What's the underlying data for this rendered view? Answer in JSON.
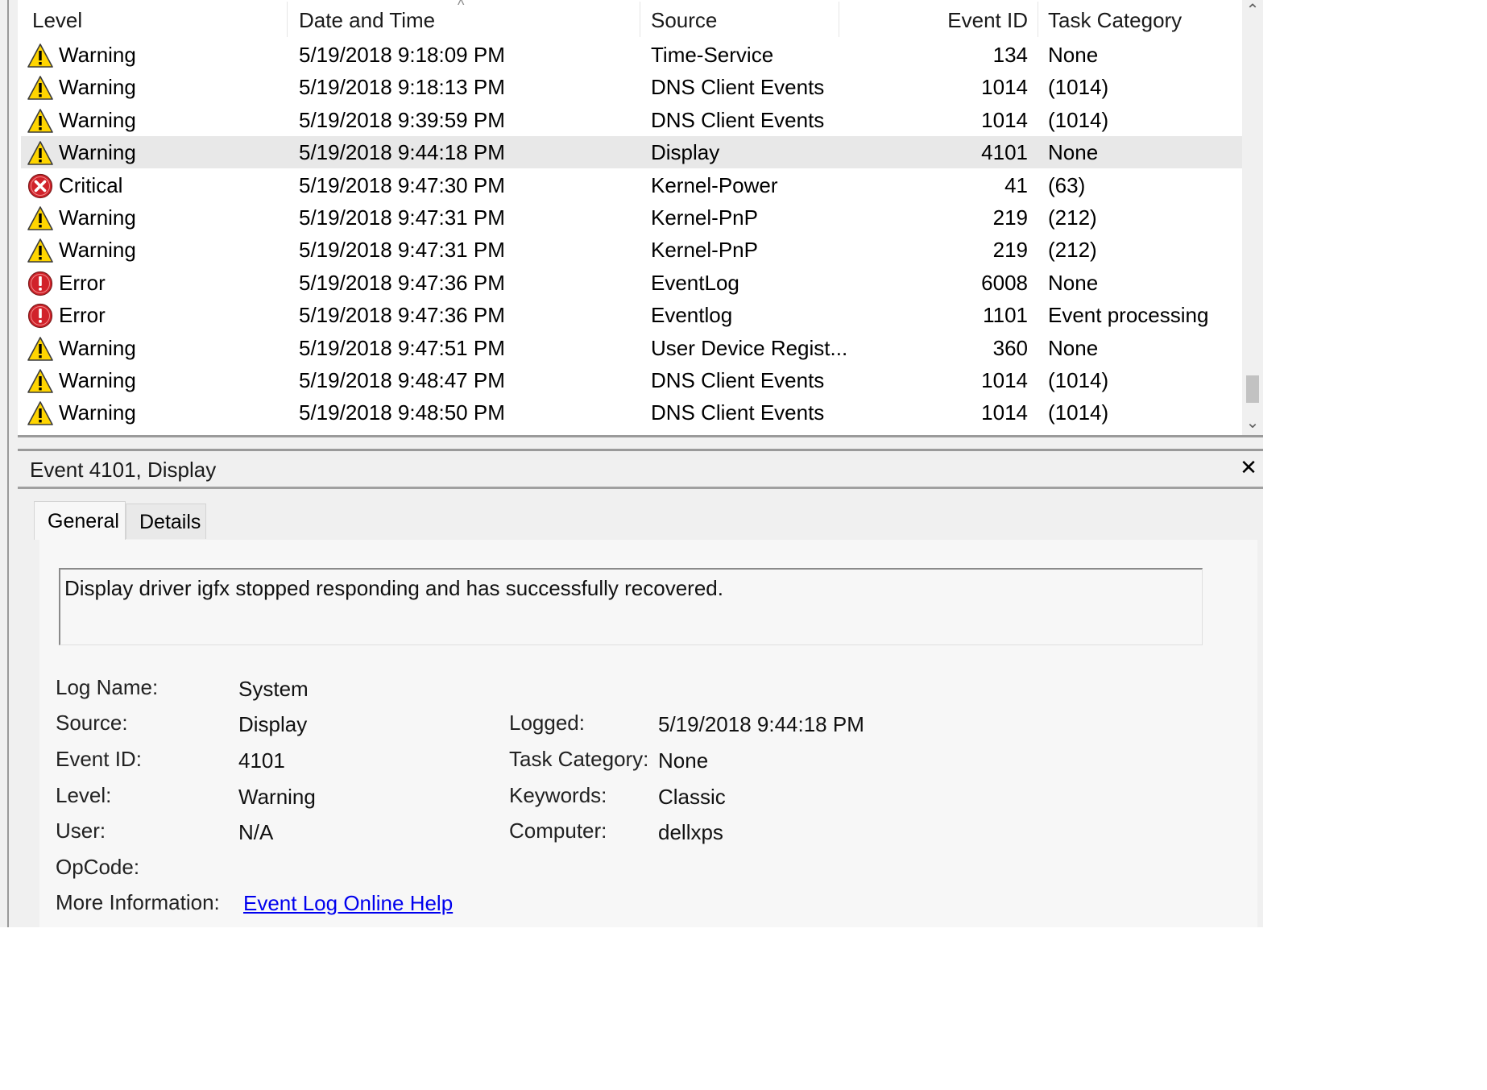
{
  "columns": {
    "level": "Level",
    "date": "Date and Time",
    "source": "Source",
    "event_id": "Event ID",
    "task": "Task Category"
  },
  "rows": [
    {
      "level": "Warning",
      "icon": "warning-icon",
      "date": "5/19/2018 9:18:09 PM",
      "source": "Time-Service",
      "event_id": "134",
      "task": "None"
    },
    {
      "level": "Warning",
      "icon": "warning-icon",
      "date": "5/19/2018 9:18:13 PM",
      "source": "DNS Client Events",
      "event_id": "1014",
      "task": "(1014)"
    },
    {
      "level": "Warning",
      "icon": "warning-icon",
      "date": "5/19/2018 9:39:59 PM",
      "source": "DNS Client Events",
      "event_id": "1014",
      "task": "(1014)"
    },
    {
      "level": "Warning",
      "icon": "warning-icon",
      "date": "5/19/2018 9:44:18 PM",
      "source": "Display",
      "event_id": "4101",
      "task": "None",
      "selected": true
    },
    {
      "level": "Critical",
      "icon": "critical-icon",
      "date": "5/19/2018 9:47:30 PM",
      "source": "Kernel-Power",
      "event_id": "41",
      "task": "(63)"
    },
    {
      "level": "Warning",
      "icon": "warning-icon",
      "date": "5/19/2018 9:47:31 PM",
      "source": "Kernel-PnP",
      "event_id": "219",
      "task": "(212)"
    },
    {
      "level": "Warning",
      "icon": "warning-icon",
      "date": "5/19/2018 9:47:31 PM",
      "source": "Kernel-PnP",
      "event_id": "219",
      "task": "(212)"
    },
    {
      "level": "Error",
      "icon": "error-icon",
      "date": "5/19/2018 9:47:36 PM",
      "source": "EventLog",
      "event_id": "6008",
      "task": "None"
    },
    {
      "level": "Error",
      "icon": "error-icon",
      "date": "5/19/2018 9:47:36 PM",
      "source": "Eventlog",
      "event_id": "1101",
      "task": "Event processing"
    },
    {
      "level": "Warning",
      "icon": "warning-icon",
      "date": "5/19/2018 9:47:51 PM",
      "source": "User Device Regist...",
      "event_id": "360",
      "task": "None"
    },
    {
      "level": "Warning",
      "icon": "warning-icon",
      "date": "5/19/2018 9:48:47 PM",
      "source": "DNS Client Events",
      "event_id": "1014",
      "task": "(1014)"
    },
    {
      "level": "Warning",
      "icon": "warning-icon",
      "date": "5/19/2018 9:48:50 PM",
      "source": "DNS Client Events",
      "event_id": "1014",
      "task": "(1014)"
    }
  ],
  "detail": {
    "title": "Event 4101, Display",
    "tabs": {
      "general": "General",
      "details": "Details"
    },
    "message": "Display driver igfx stopped responding and has successfully recovered.",
    "labels": {
      "log_name": "Log Name:",
      "source": "Source:",
      "event_id": "Event ID:",
      "level": "Level:",
      "user": "User:",
      "opcode": "OpCode:",
      "more_info": "More Information:",
      "logged": "Logged:",
      "task_category": "Task Category:",
      "keywords": "Keywords:",
      "computer": "Computer:"
    },
    "values": {
      "log_name": "System",
      "source": "Display",
      "event_id": "4101",
      "level": "Warning",
      "user": "N/A",
      "opcode": "",
      "more_info": "Event Log Online Help",
      "logged": "5/19/2018 9:44:18 PM",
      "task_category": "None",
      "keywords": "Classic",
      "computer": "dellxps"
    }
  },
  "colors": {
    "warning": "#ffd500",
    "error": "#d1222a",
    "selected_row": "#e8e8e8",
    "link": "#0000ee"
  }
}
